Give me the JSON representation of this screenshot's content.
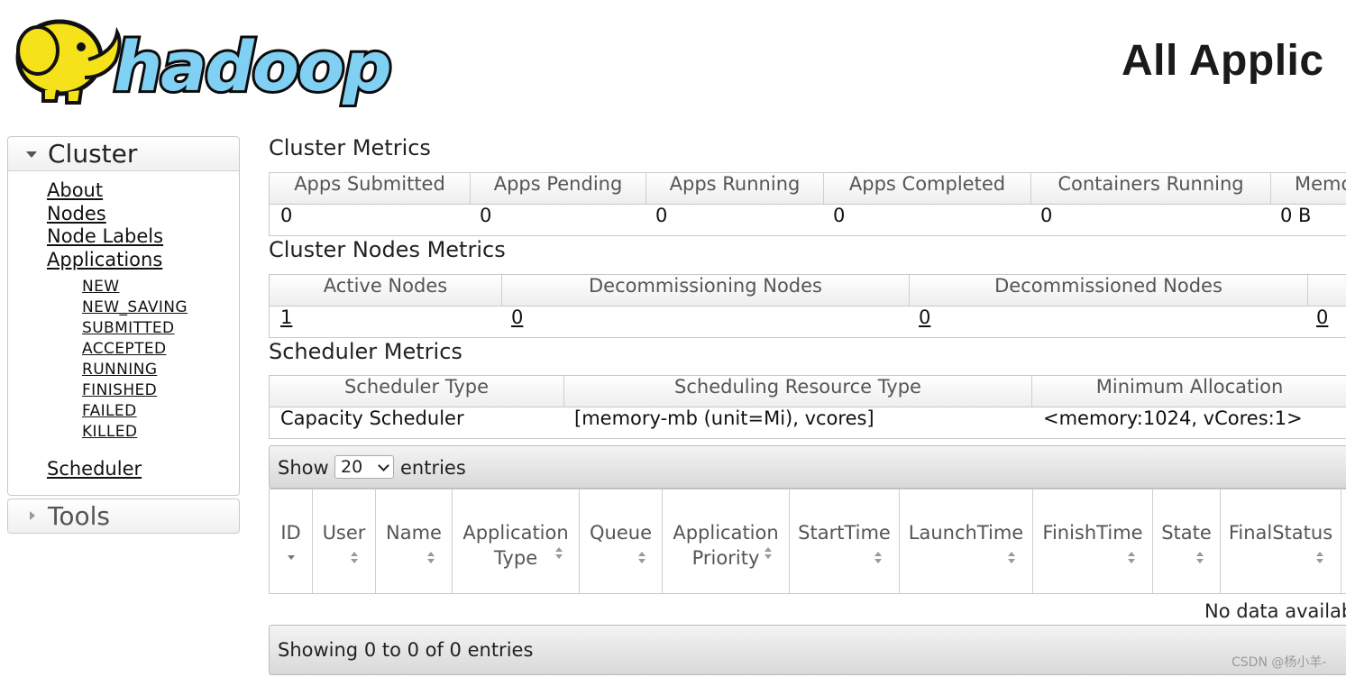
{
  "header": {
    "logo_text": "hadoop",
    "page_title": "All Applic"
  },
  "sidebar": {
    "cluster_label": "Cluster",
    "links": [
      "About",
      "Nodes",
      "Node Labels",
      "Applications"
    ],
    "app_states": [
      "NEW",
      "NEW_SAVING",
      "SUBMITTED",
      "ACCEPTED",
      "RUNNING",
      "FINISHED",
      "FAILED",
      "KILLED"
    ],
    "scheduler_link": "Scheduler",
    "tools_label": "Tools"
  },
  "cluster_metrics": {
    "title": "Cluster Metrics",
    "headers": [
      "Apps Submitted",
      "Apps Pending",
      "Apps Running",
      "Apps Completed",
      "Containers Running",
      "Memo"
    ],
    "values": [
      "0",
      "0",
      "0",
      "0",
      "0",
      "0 B"
    ]
  },
  "node_metrics": {
    "title": "Cluster Nodes Metrics",
    "headers": [
      "Active Nodes",
      "Decommissioning Nodes",
      "Decommissioned Nodes"
    ],
    "values": [
      "1",
      "0",
      "0",
      "0"
    ]
  },
  "scheduler_metrics": {
    "title": "Scheduler Metrics",
    "headers": [
      "Scheduler Type",
      "Scheduling Resource Type",
      "Minimum Allocation"
    ],
    "values": [
      "Capacity Scheduler",
      "[memory-mb (unit=Mi), vcores]",
      "<memory:1024, vCores:1>"
    ]
  },
  "apps_table": {
    "show_label": "Show",
    "page_size": "20",
    "entries_label": "entries",
    "columns": [
      "ID",
      "User",
      "Name",
      "Application Type",
      "Queue",
      "Application Priority",
      "StartTime",
      "LaunchTime",
      "FinishTime",
      "State",
      "FinalStatus"
    ],
    "empty_text": "No data availab",
    "info_text": "Showing 0 to 0 of 0 entries"
  },
  "watermark": "CSDN @杨小羊-",
  "colors": {
    "logo_yellow": "#f5e21a",
    "logo_blue": "#7fd0f2",
    "logo_dark": "#0c0c0c"
  }
}
